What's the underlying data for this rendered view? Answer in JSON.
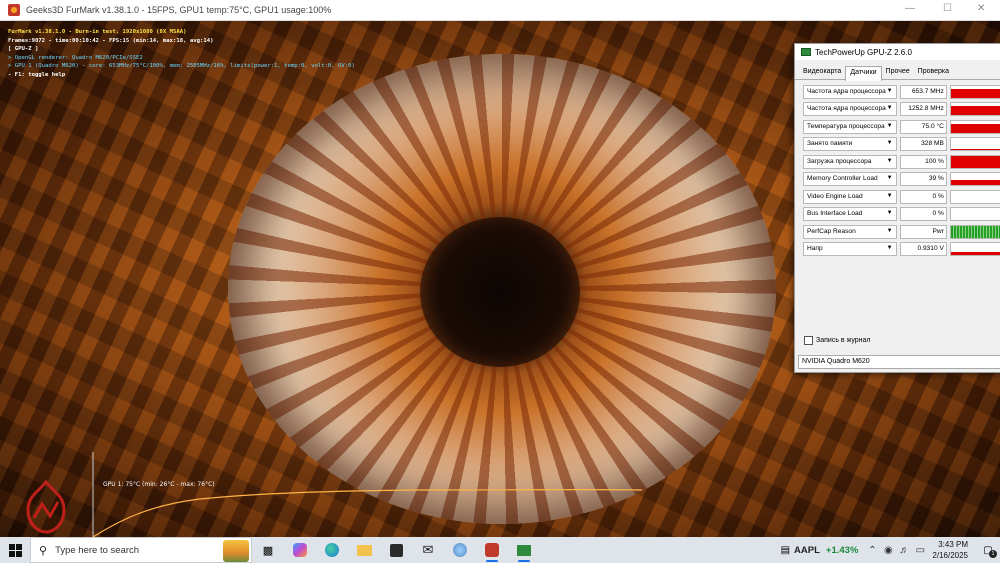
{
  "furmark": {
    "title": "Geeks3D FurMark v1.38.1.0 - 15FPS, GPU1 temp:75°C, GPU1 usage:100%",
    "osd": {
      "line1": "FurMark v1.38.1.0 - Burn-in test, 1920x1080 (8X MSAA)",
      "line2": "Frames:9072 - time:00:10:42 - FPS:15 (min:14, max:18, avg:14)",
      "line3": "[ GPU-Z ]",
      "line4": "> OpenGL renderer: Quadro M620/PCIe/SSE2",
      "line5": "> GPU 1 (Quadro M620) - core: 653MHz/75°C/100%, mem: 2505MHz/16%, limits(power:1, temp:0, volt:0, OV:0)",
      "line6": "- F1: toggle help"
    },
    "temp_graph_label": "GPU 1: 75°C (min: 26°C - max: 76°C)"
  },
  "gpuz": {
    "title": "TechPowerUp GPU-Z 2.6.0",
    "tabs": [
      "Видеокарта",
      "Датчики",
      "Прочее",
      "Проверка"
    ],
    "active_tab": "Датчики",
    "sensors": [
      {
        "name": "Частота ядра процессора",
        "value": "653.7 MHz",
        "level": 0.75
      },
      {
        "name": "Частота ядра процессора",
        "value": "1252.8 MHz",
        "level": 0.75
      },
      {
        "name": "Температура процессора",
        "value": "75.0 °C",
        "level": 0.7
      },
      {
        "name": "Занято памяти",
        "value": "328 MB",
        "level": 0.1
      },
      {
        "name": "Загрузка процессора",
        "value": "100 %",
        "level": 0.95
      },
      {
        "name": "Memory Controller Load",
        "value": "39 %",
        "level": 0.4
      },
      {
        "name": "Video Engine Load",
        "value": "0 %",
        "level": 0
      },
      {
        "name": "Bus Interface Load",
        "value": "0 %",
        "level": 0
      },
      {
        "name": "PerfCap Reason",
        "value": "Pwr",
        "level": 0
      },
      {
        "name": "Напр",
        "value": "0.9310 V",
        "level": 0.25
      }
    ],
    "log_label": "Запись в журнал",
    "gpu_name": "NVIDIA Quadro M620"
  },
  "taskbar": {
    "search_placeholder": "Type here to search",
    "stock_ticker": "AAPL",
    "stock_change": "+1.43%",
    "time": "3:43 PM",
    "date": "2/16/2025",
    "notification_count": "1"
  },
  "colors": {
    "graph_red": "#e00000",
    "graph_green": "#25a025",
    "osd_yellow": "#ffe24a",
    "osd_cyan": "#6ed8ff",
    "temp_curve": "#ffb347"
  }
}
